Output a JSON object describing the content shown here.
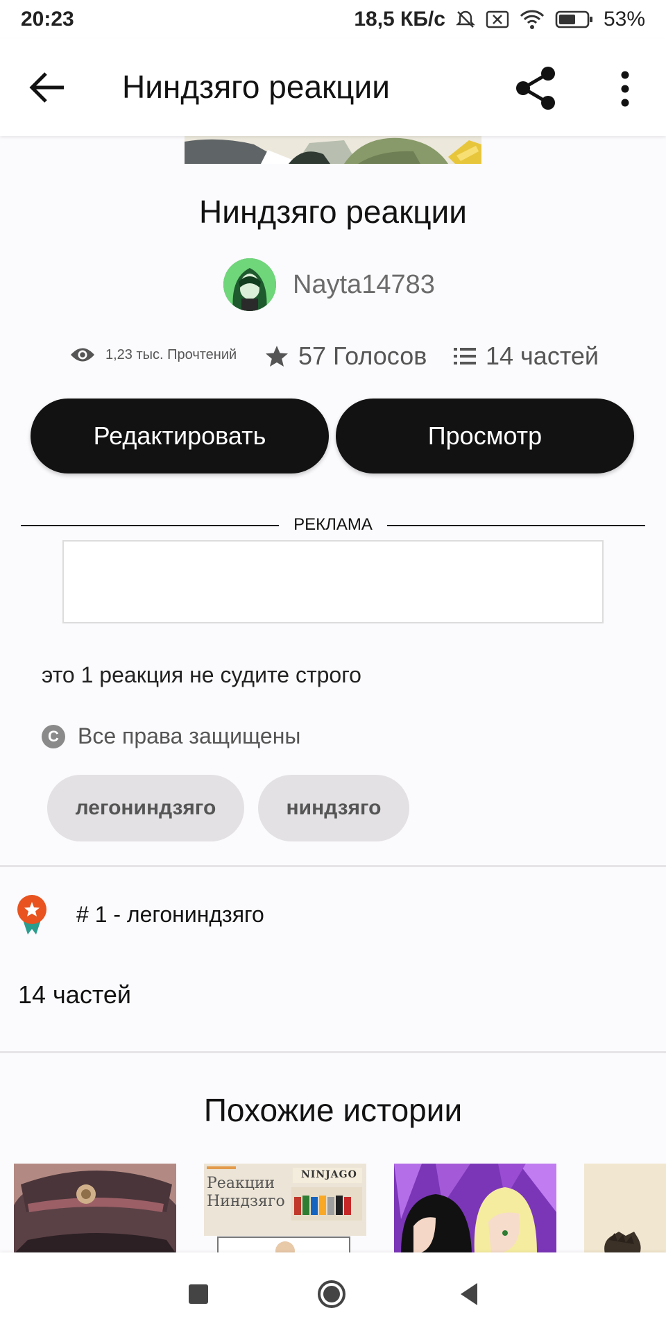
{
  "status_bar": {
    "time": "20:23",
    "network_speed": "18,5 КБ/с",
    "battery": "53%"
  },
  "app_bar": {
    "title": "Ниндзяго реакции",
    "icons": [
      "back-arrow-icon",
      "share-icon",
      "more-vert-icon"
    ]
  },
  "story": {
    "title": "Ниндзяго реакции",
    "author": "Nayta14783",
    "stats": {
      "reads": "1,23 тыс. Прочтений",
      "votes": "57 Голосов",
      "parts": "14 частей"
    },
    "buttons": {
      "edit": "Редактировать",
      "view": "Просмотр"
    },
    "ad_label": "РЕКЛАМА",
    "description": "это 1 реакция не судите строго",
    "copyright": "Все права защищены",
    "copyright_symbol": "C",
    "tags": [
      "легониндзяго",
      "ниндзяго"
    ],
    "rank": "# 1 - легониндзяго",
    "parts_count": "14 частей"
  },
  "similar": {
    "title": "Похожие истории",
    "thumb2_text": "Реакции Ниндзяго",
    "thumb2_badge": "NINJAGO"
  },
  "colors": {
    "button_bg": "#121212",
    "tag_bg": "#e3e1e4",
    "rank_badge": "#e8531f",
    "rank_ribbon": "#2a9d8f"
  }
}
